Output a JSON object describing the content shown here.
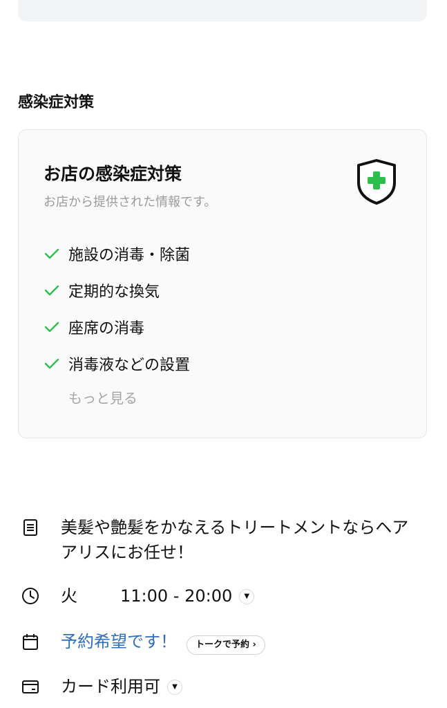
{
  "section": {
    "title": "感染症対策"
  },
  "card": {
    "title": "お店の感染症対策",
    "subtitle": "お店から提供された情報です。",
    "shield_icon": "shield-plus-icon",
    "accent_color": "#2dbe4e",
    "measures": [
      {
        "label": "施設の消毒・除菌"
      },
      {
        "label": "定期的な換気"
      },
      {
        "label": "座席の消毒"
      },
      {
        "label": "消毒液などの設置"
      }
    ],
    "more_label": "もっと見る"
  },
  "info": {
    "description": "美髪や艶髪をかなえるトリートメントならヘアアリスにお任せ！",
    "hours": {
      "day": "火",
      "time": "11:00 - 20:00"
    },
    "reservation": {
      "label": "予約希望です！",
      "talk_button": "トークで予約 ›"
    },
    "payment": {
      "label": "カード利用可"
    }
  }
}
